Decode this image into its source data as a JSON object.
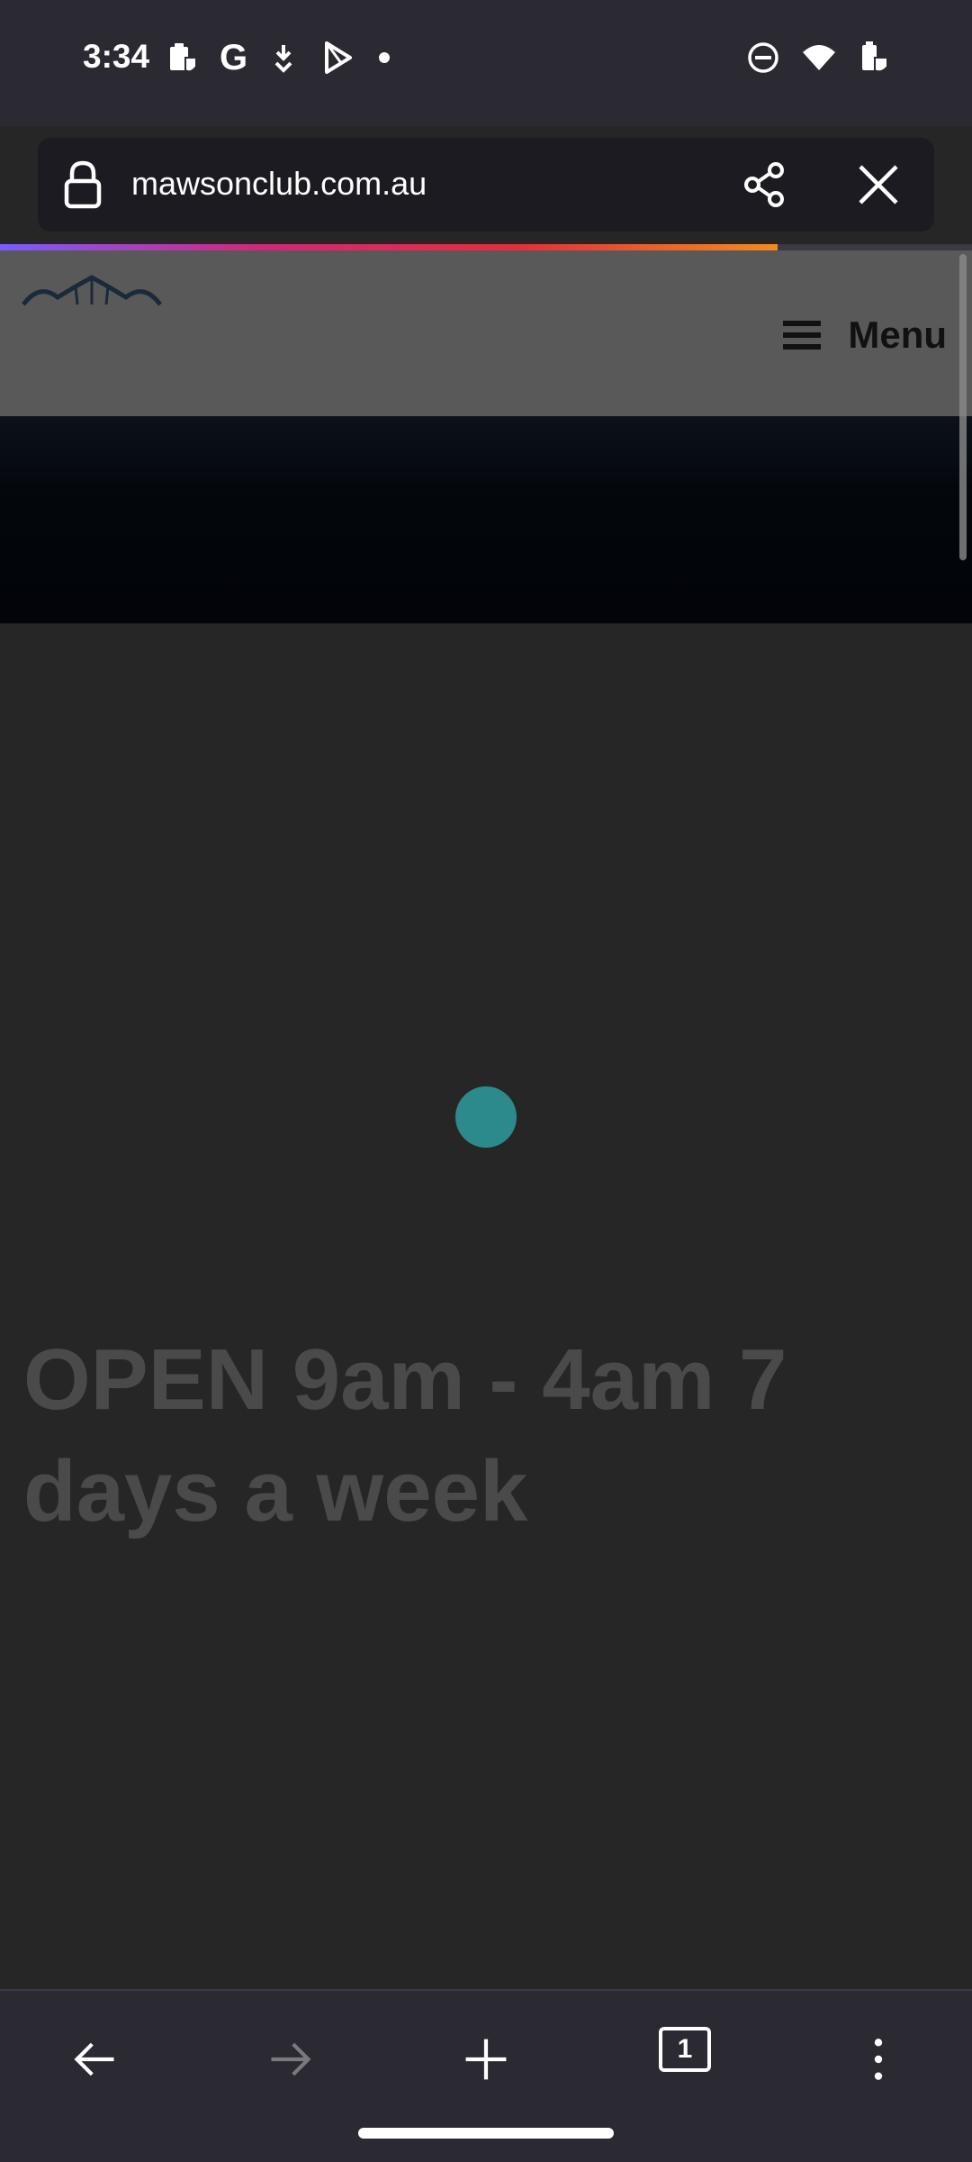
{
  "status_bar": {
    "time": "3:34",
    "left_icons": [
      "clipboard-shield-icon",
      "google-icon",
      "download-arrow-icon",
      "play-store-icon",
      "dot-icon"
    ],
    "right_icons": [
      "do-not-disturb-icon",
      "wifi-icon",
      "battery-shield-icon"
    ],
    "google_letter": "G"
  },
  "browser": {
    "url": "mawsonclub.com.au",
    "load_progress": 0.8,
    "progress_gradient": [
      "#7a5cff",
      "#d0287a",
      "#e0303a",
      "#f08c20"
    ]
  },
  "page": {
    "menu_label": "Menu",
    "heading": "OPEN 9am - 4am 7 days a week",
    "spinner_color": "#2c8a8c"
  },
  "toolbar": {
    "tab_count": "1",
    "buttons": [
      "back-icon",
      "forward-icon",
      "new-tab-icon",
      "tabs-icon",
      "more-options-icon"
    ]
  }
}
